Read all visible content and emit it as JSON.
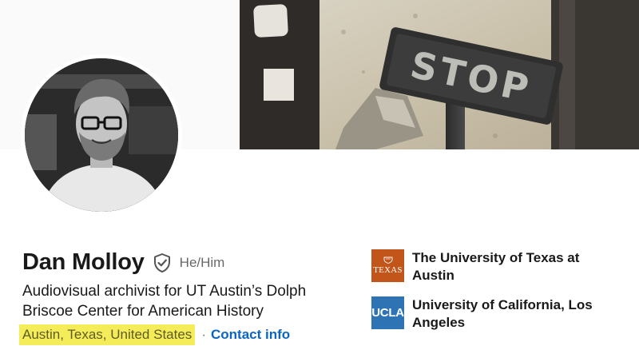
{
  "profile": {
    "name": "Dan Molloy",
    "pronouns": "He/Him",
    "headline": "Audiovisual archivist for UT Austin’s Dolph Briscoe Center for American History",
    "location": "Austin, Texas, United States",
    "separator": "·",
    "contact_label": "Contact info"
  },
  "banner": {
    "sign_text": "STOP"
  },
  "education": [
    {
      "name": "The University of Texas at Austin",
      "logo_text": "TEXAS",
      "logo_color": "#c2561a"
    },
    {
      "name": "University of California, Los Angeles",
      "logo_text": "UCLA",
      "logo_color": "#2e74b5"
    }
  ],
  "colors": {
    "link": "#0a66c2",
    "location_highlight": "#f5ec5a"
  },
  "icons": {
    "verified": "shield-check-icon"
  }
}
